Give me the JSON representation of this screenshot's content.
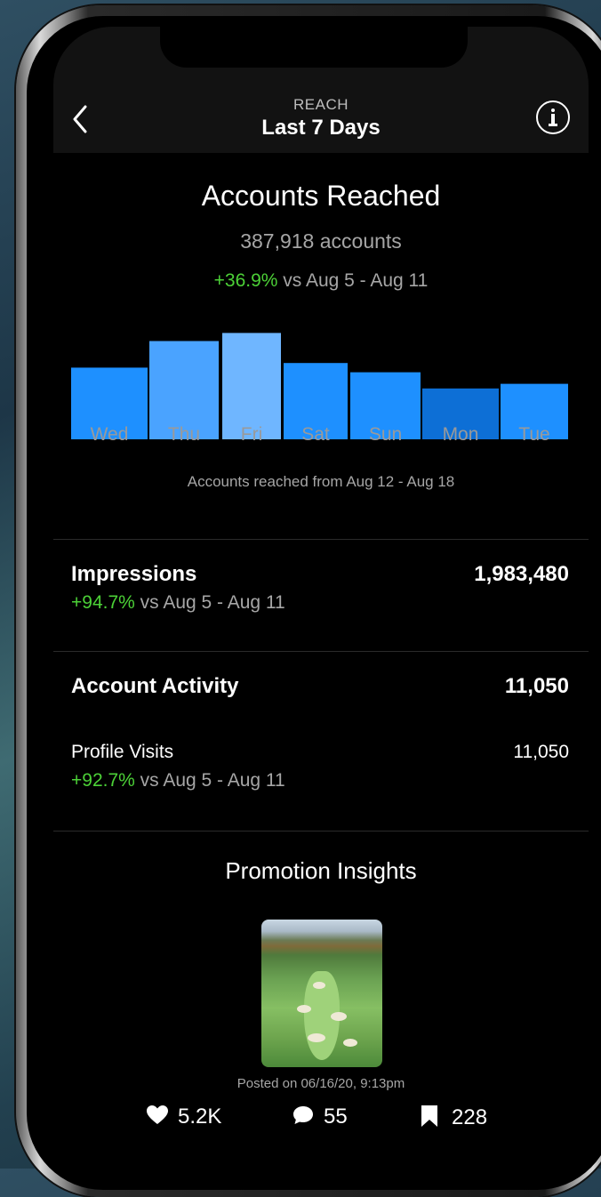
{
  "header": {
    "subtitle": "REACH",
    "title": "Last 7 Days"
  },
  "reach": {
    "title": "Accounts Reached",
    "count": "387,918 accounts",
    "change": "+36.9%",
    "change_suffix": " vs Aug 5 - Aug 11",
    "caption": "Accounts reached from Aug 12 - Aug 18"
  },
  "chart_data": {
    "type": "bar",
    "categories": [
      "Wed",
      "Thu",
      "Fri",
      "Sat",
      "Sun",
      "Mon",
      "Tue"
    ],
    "values": [
      62,
      85,
      92,
      66,
      58,
      44,
      48
    ],
    "colors": [
      "#1e90ff",
      "#4aa3ff",
      "#6fb6ff",
      "#1e90ff",
      "#1e90ff",
      "#0d6fd6",
      "#1e90ff"
    ],
    "title": "",
    "xlabel": "",
    "ylabel": "",
    "ylim": [
      0,
      100
    ]
  },
  "impressions": {
    "label": "Impressions",
    "value": "1,983,480",
    "change": "+94.7%",
    "change_suffix": " vs Aug 5 - Aug 11"
  },
  "activity": {
    "label": "Account Activity",
    "value": "11,050",
    "profile_label": "Profile Visits",
    "profile_value": "11,050",
    "change": "+92.7%",
    "change_suffix": " vs Aug 5 - Aug 11"
  },
  "promotion": {
    "title": "Promotion Insights",
    "posted": "Posted on 06/16/20, 9:13pm",
    "likes": "5.2K",
    "comments": "55",
    "saves": "228"
  },
  "colors": {
    "accent_green": "#4cd137",
    "bar_blue": "#1e90ff"
  },
  "icons": {
    "back": "chevron-left-icon",
    "info": "info-icon",
    "like": "heart-icon",
    "comment": "comment-bubble-icon",
    "save": "bookmark-icon"
  }
}
